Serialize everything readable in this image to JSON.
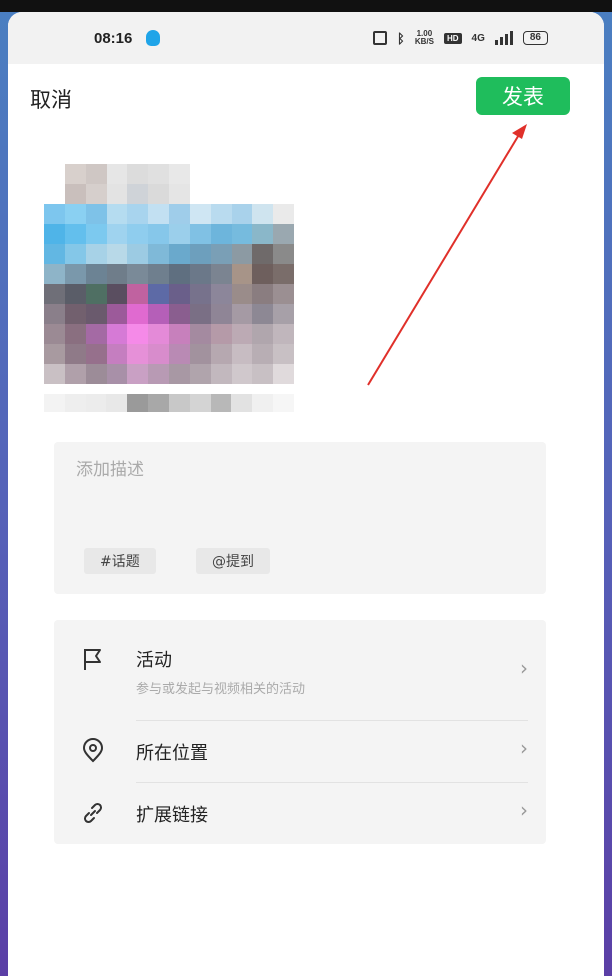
{
  "status_bar": {
    "time": "08:16",
    "speed_top": "1.00",
    "speed_bottom": "KB/S",
    "hd": "HD",
    "signal": "4G",
    "battery": "86"
  },
  "header": {
    "cancel_label": "取消",
    "publish_label": "发表",
    "publish_color": "#1fbd5c"
  },
  "description": {
    "placeholder": "添加描述",
    "topic_chip": "#话题",
    "mention_chip": "@提到"
  },
  "options": {
    "activity_title": "活动",
    "activity_subtitle": "参与或发起与视频相关的活动",
    "location_title": "所在位置",
    "link_title": "扩展链接"
  },
  "icons": [
    "flag-icon",
    "location-pin-icon",
    "link-icon",
    "chevron-right-icon",
    "bluetooth-icon",
    "nfc-icon"
  ]
}
